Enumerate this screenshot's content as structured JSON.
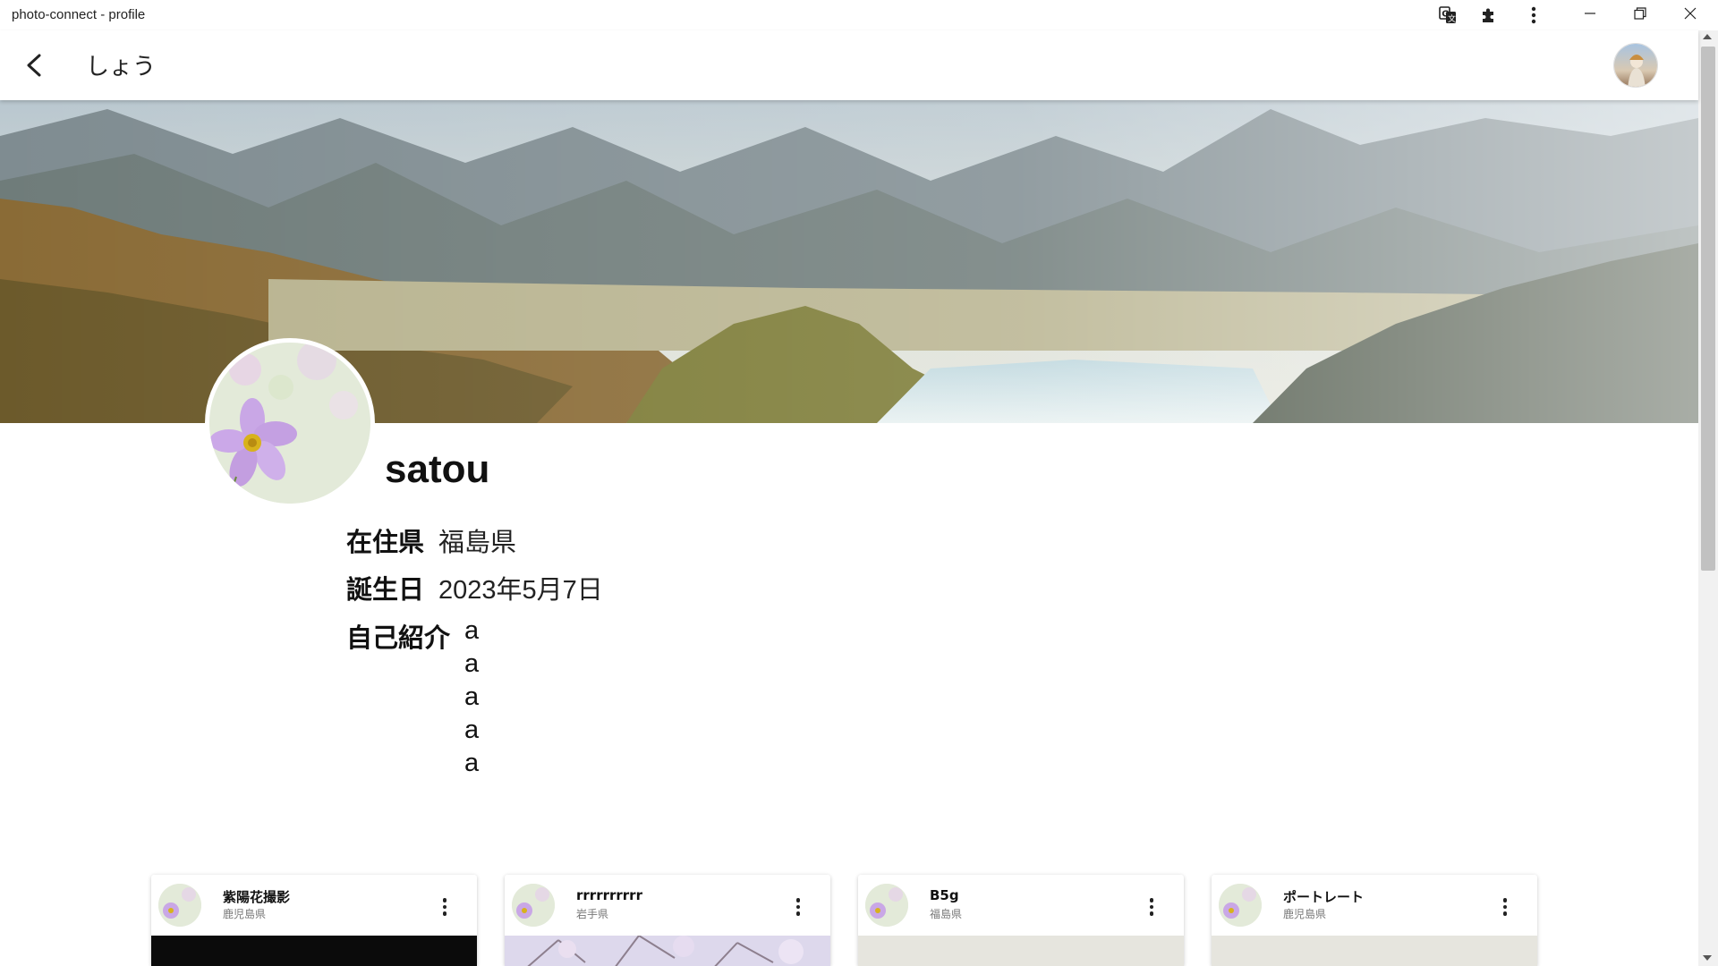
{
  "window": {
    "title": "photo-connect - profile",
    "icons": [
      "translate-icon",
      "extensions-icon",
      "more-vert-icon"
    ],
    "controls": [
      "minimize-icon",
      "restore-icon",
      "close-icon"
    ]
  },
  "appbar": {
    "back_icon": "arrow-back-icon",
    "title": "しょう"
  },
  "profile": {
    "username": "satou",
    "prefecture_label": "在住県",
    "prefecture_value": "福島県",
    "birthday_label": "誕生日",
    "birthday_value": "2023年5月7日",
    "bio_label": "自己紹介",
    "bio_lines": [
      "a",
      "a",
      "a",
      "a",
      "a"
    ]
  },
  "posts": [
    {
      "title": "紫陽花撮影",
      "prefecture": "鹿児島県",
      "image": "dark"
    },
    {
      "title": "rrrrrrrrrr",
      "prefecture": "岩手県",
      "image": "blossom"
    },
    {
      "title": "B5g",
      "prefecture": "福島県",
      "image": "pale"
    },
    {
      "title": "ポートレート",
      "prefecture": "鹿児島県",
      "image": "pale"
    }
  ],
  "colors": {
    "appbar_bg": "#ffffff",
    "scrollbar_track": "#f1f1f1",
    "scrollbar_thumb": "#c1c1c1",
    "card_image_dark": "#0b0b0b",
    "card_image_blossom": "#dcd6ec",
    "card_image_pale": "#e6e5de"
  }
}
